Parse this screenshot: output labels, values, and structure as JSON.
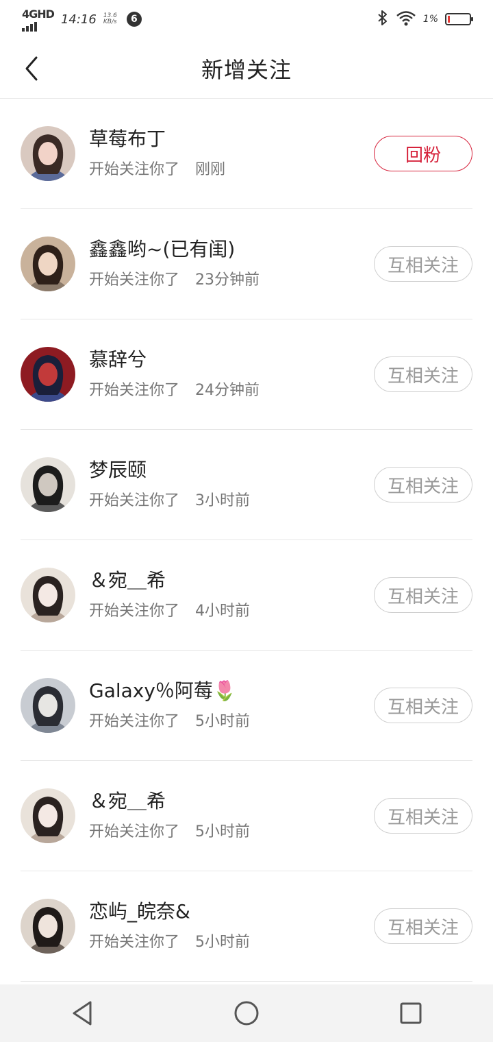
{
  "status_bar": {
    "network": "4GHD",
    "time": "14:16",
    "speed_value": "13.6",
    "speed_unit": "KB/s",
    "notification_badge": "6",
    "battery_percent": "1%",
    "icons": [
      "bluetooth-icon",
      "wifi-icon",
      "battery-icon"
    ]
  },
  "header": {
    "title": "新增关注",
    "back_icon": "back-chevron-icon"
  },
  "colors": {
    "accent": "#d6233c",
    "muted_text": "#777777",
    "mutual_border": "#cfcfcf"
  },
  "followers": [
    {
      "name": "草莓布丁",
      "action": "开始关注你了",
      "time": "刚刚",
      "button": "回粉",
      "button_type": "follow",
      "avatar_palette": [
        "#d9c9c0",
        "#3a2a25",
        "#f2d3c8",
        "#5b6b9a"
      ]
    },
    {
      "name": "鑫鑫哟~(已有闺)",
      "action": "开始关注你了",
      "time": "23分钟前",
      "button": "互相关注",
      "button_type": "mutual",
      "avatar_palette": [
        "#c9b29b",
        "#2e2019",
        "#efd6c4",
        "#8b7a6a"
      ]
    },
    {
      "name": "慕辞兮",
      "action": "开始关注你了",
      "time": "24分钟前",
      "button": "互相关注",
      "button_type": "mutual",
      "avatar_palette": [
        "#8e1b22",
        "#1a1f3a",
        "#c23a3a",
        "#3b4a8a"
      ]
    },
    {
      "name": "梦辰颐",
      "action": "开始关注你了",
      "time": "3小时前",
      "button": "互相关注",
      "button_type": "mutual",
      "avatar_palette": [
        "#e6e2dc",
        "#1c1c1c",
        "#cfc8c0",
        "#5a5a5a"
      ]
    },
    {
      "name": "＆宛＿希",
      "action": "开始关注你了",
      "time": "4小时前",
      "button": "互相关注",
      "button_type": "mutual",
      "avatar_palette": [
        "#e9e2da",
        "#2a2220",
        "#f4e9e4",
        "#b8a79a"
      ]
    },
    {
      "name": "Galaxy％阿莓🌷",
      "action": "开始关注你了",
      "time": "5小时前",
      "button": "互相关注",
      "button_type": "mutual",
      "avatar_palette": [
        "#c8ccd2",
        "#2a2c33",
        "#e7e6e3",
        "#7f8794"
      ]
    },
    {
      "name": "＆宛＿希",
      "action": "开始关注你了",
      "time": "5小时前",
      "button": "互相关注",
      "button_type": "mutual",
      "avatar_palette": [
        "#e9e2da",
        "#2a2220",
        "#f4e9e4",
        "#b8a79a"
      ]
    },
    {
      "name": "恋屿_皖奈&",
      "action": "开始关注你了",
      "time": "5小时前",
      "button": "互相关注",
      "button_type": "mutual",
      "avatar_palette": [
        "#ddd4cb",
        "#1f1a18",
        "#efe4dc",
        "#6e635b"
      ]
    }
  ],
  "nav_bar": {
    "icons": [
      "back-triangle-icon",
      "home-circle-icon",
      "recents-square-icon"
    ]
  }
}
